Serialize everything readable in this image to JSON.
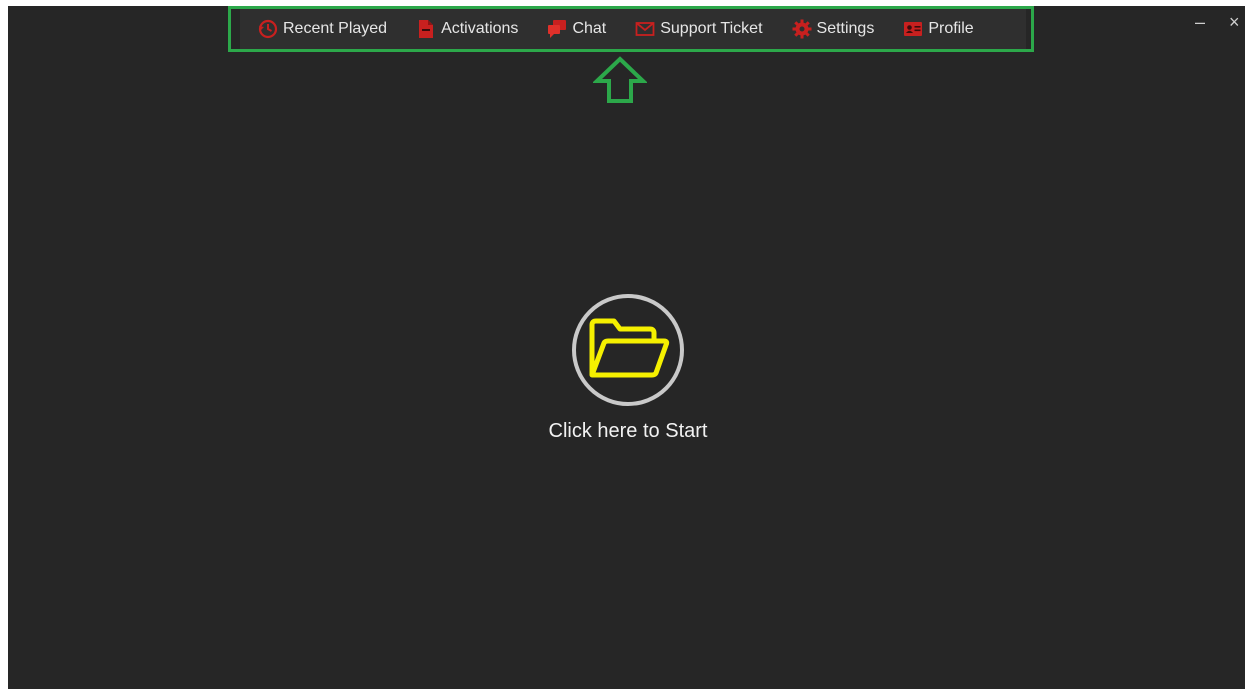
{
  "nav": {
    "items": [
      {
        "label": "Recent Played",
        "icon": "history-icon"
      },
      {
        "label": "Activations",
        "icon": "document-icon"
      },
      {
        "label": "Chat",
        "icon": "chat-icon"
      },
      {
        "label": "Support Ticket",
        "icon": "mail-icon"
      },
      {
        "label": "Settings",
        "icon": "gear-icon"
      },
      {
        "label": "Profile",
        "icon": "id-card-icon"
      }
    ]
  },
  "window_controls": {
    "minimize": "–",
    "close": "×"
  },
  "start": {
    "label": "Click here to Start",
    "icon": "folder-open-icon"
  },
  "colors": {
    "background": "#262626",
    "icon_accent": "#c8201f",
    "highlight": "#2ca84a",
    "folder": "#f5f000"
  }
}
